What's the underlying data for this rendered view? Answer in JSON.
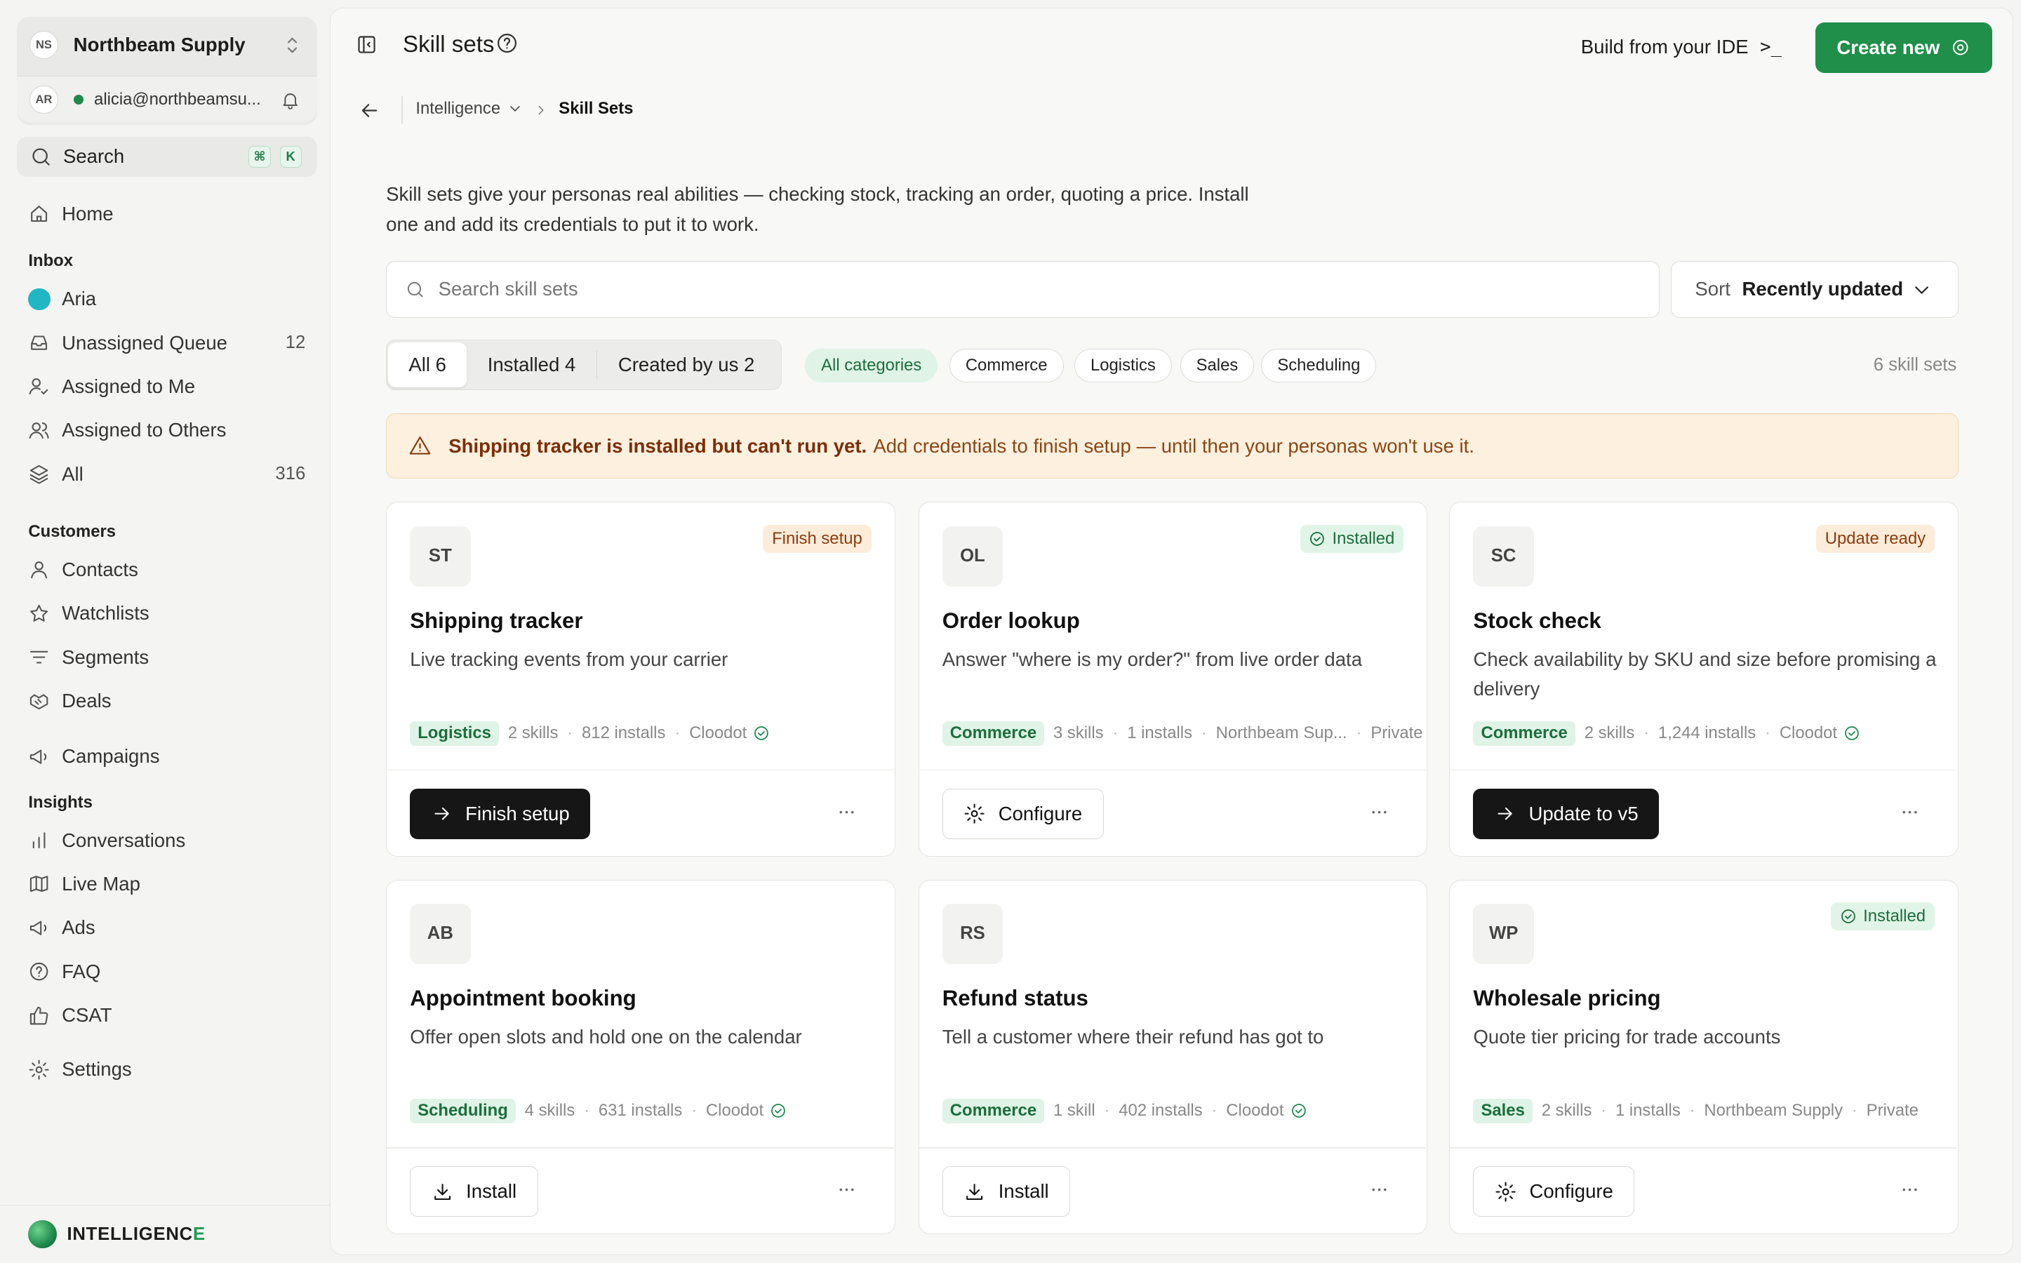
{
  "workspace": {
    "initials": "NS",
    "name": "Northbeam Supply",
    "user_initials": "AR",
    "user_email": "alicia@northbeamsu..."
  },
  "search": {
    "label": "Search",
    "kbd1": "⌘",
    "kbd2": "K"
  },
  "nav": {
    "home": "Home",
    "inbox_header": "Inbox",
    "aria": "Aria",
    "unassigned": "Unassigned Queue",
    "unassigned_count": "12",
    "assigned_me": "Assigned to Me",
    "assigned_others": "Assigned to Others",
    "all": "All",
    "all_count": "316",
    "customers_header": "Customers",
    "contacts": "Contacts",
    "watchlists": "Watchlists",
    "segments": "Segments",
    "deals": "Deals",
    "campaigns": "Campaigns",
    "insights_header": "Insights",
    "conversations": "Conversations",
    "live_map": "Live Map",
    "ads": "Ads",
    "faq": "FAQ",
    "csat": "CSAT",
    "settings": "Settings"
  },
  "brand": {
    "part1": "INTELLIGENC",
    "part2": "E"
  },
  "header": {
    "title": "Skill sets",
    "ide_label": "Build from your IDE",
    "ide_prompt": ">_",
    "create_label": "Create new"
  },
  "breadcrumb": {
    "parent": "Intelligence",
    "current": "Skill Sets"
  },
  "intro": "Skill sets give your personas real abilities — checking stock, tracking an order, quoting a price. Install one and add its credentials to put it to work.",
  "skill_search": {
    "placeholder": "Search skill sets"
  },
  "sort": {
    "label": "Sort",
    "value": "Recently updated"
  },
  "segments": {
    "all": "All 6",
    "installed": "Installed 4",
    "created": "Created by us 2"
  },
  "categories": {
    "all": "All categories",
    "commerce": "Commerce",
    "logistics": "Logistics",
    "sales": "Sales",
    "scheduling": "Scheduling"
  },
  "count_label": "6 skill sets",
  "alert": {
    "strong": "Shipping tracker is installed but can't run yet.",
    "rest": "Add credentials to finish setup — until then your personas won't use it."
  },
  "colors": {
    "accent": "#1f8f4a",
    "warning_bg": "#fdf0df",
    "tag_bg": "#dff3e6",
    "tag_text": "#1c6e3c",
    "aria_dot": "#22b5c3"
  },
  "cards": [
    {
      "initials": "ST",
      "status": "Finish setup",
      "title": "Shipping tracker",
      "desc": "Live tracking events from your carrier",
      "tag": "Logistics",
      "skills": "2 skills",
      "installs": "812 installs",
      "author": "Cloodot",
      "action": "Finish setup",
      "action_icon": "arrow-right-icon"
    },
    {
      "initials": "OL",
      "status": "Installed",
      "title": "Order lookup",
      "desc": "Answer \"where is my order?\" from live order data",
      "tag": "Commerce",
      "skills": "3 skills",
      "installs": "1 installs",
      "author": "Northbeam Sup...",
      "visibility": "Private",
      "action": "Configure",
      "action_icon": "gear-icon"
    },
    {
      "initials": "SC",
      "status": "Update ready",
      "title": "Stock check",
      "desc": "Check availability by SKU and size before promising a delivery",
      "tag": "Commerce",
      "skills": "2 skills",
      "installs": "1,244 installs",
      "author": "Cloodot",
      "action": "Update to v5",
      "action_icon": "arrow-right-icon"
    },
    {
      "initials": "AB",
      "title": "Appointment booking",
      "desc": "Offer open slots and hold one on the calendar",
      "tag": "Scheduling",
      "skills": "4 skills",
      "installs": "631 installs",
      "author": "Cloodot",
      "action": "Install",
      "action_icon": "download-icon"
    },
    {
      "initials": "RS",
      "title": "Refund status",
      "desc": "Tell a customer where their refund has got to",
      "tag": "Commerce",
      "skills": "1 skill",
      "installs": "402 installs",
      "author": "Cloodot",
      "action": "Install",
      "action_icon": "download-icon"
    },
    {
      "initials": "WP",
      "status": "Installed",
      "title": "Wholesale pricing",
      "desc": "Quote tier pricing for trade accounts",
      "tag": "Sales",
      "skills": "2 skills",
      "installs": "1 installs",
      "author": "Northbeam Supply",
      "visibility": "Private",
      "action": "Configure",
      "action_icon": "gear-icon"
    }
  ]
}
